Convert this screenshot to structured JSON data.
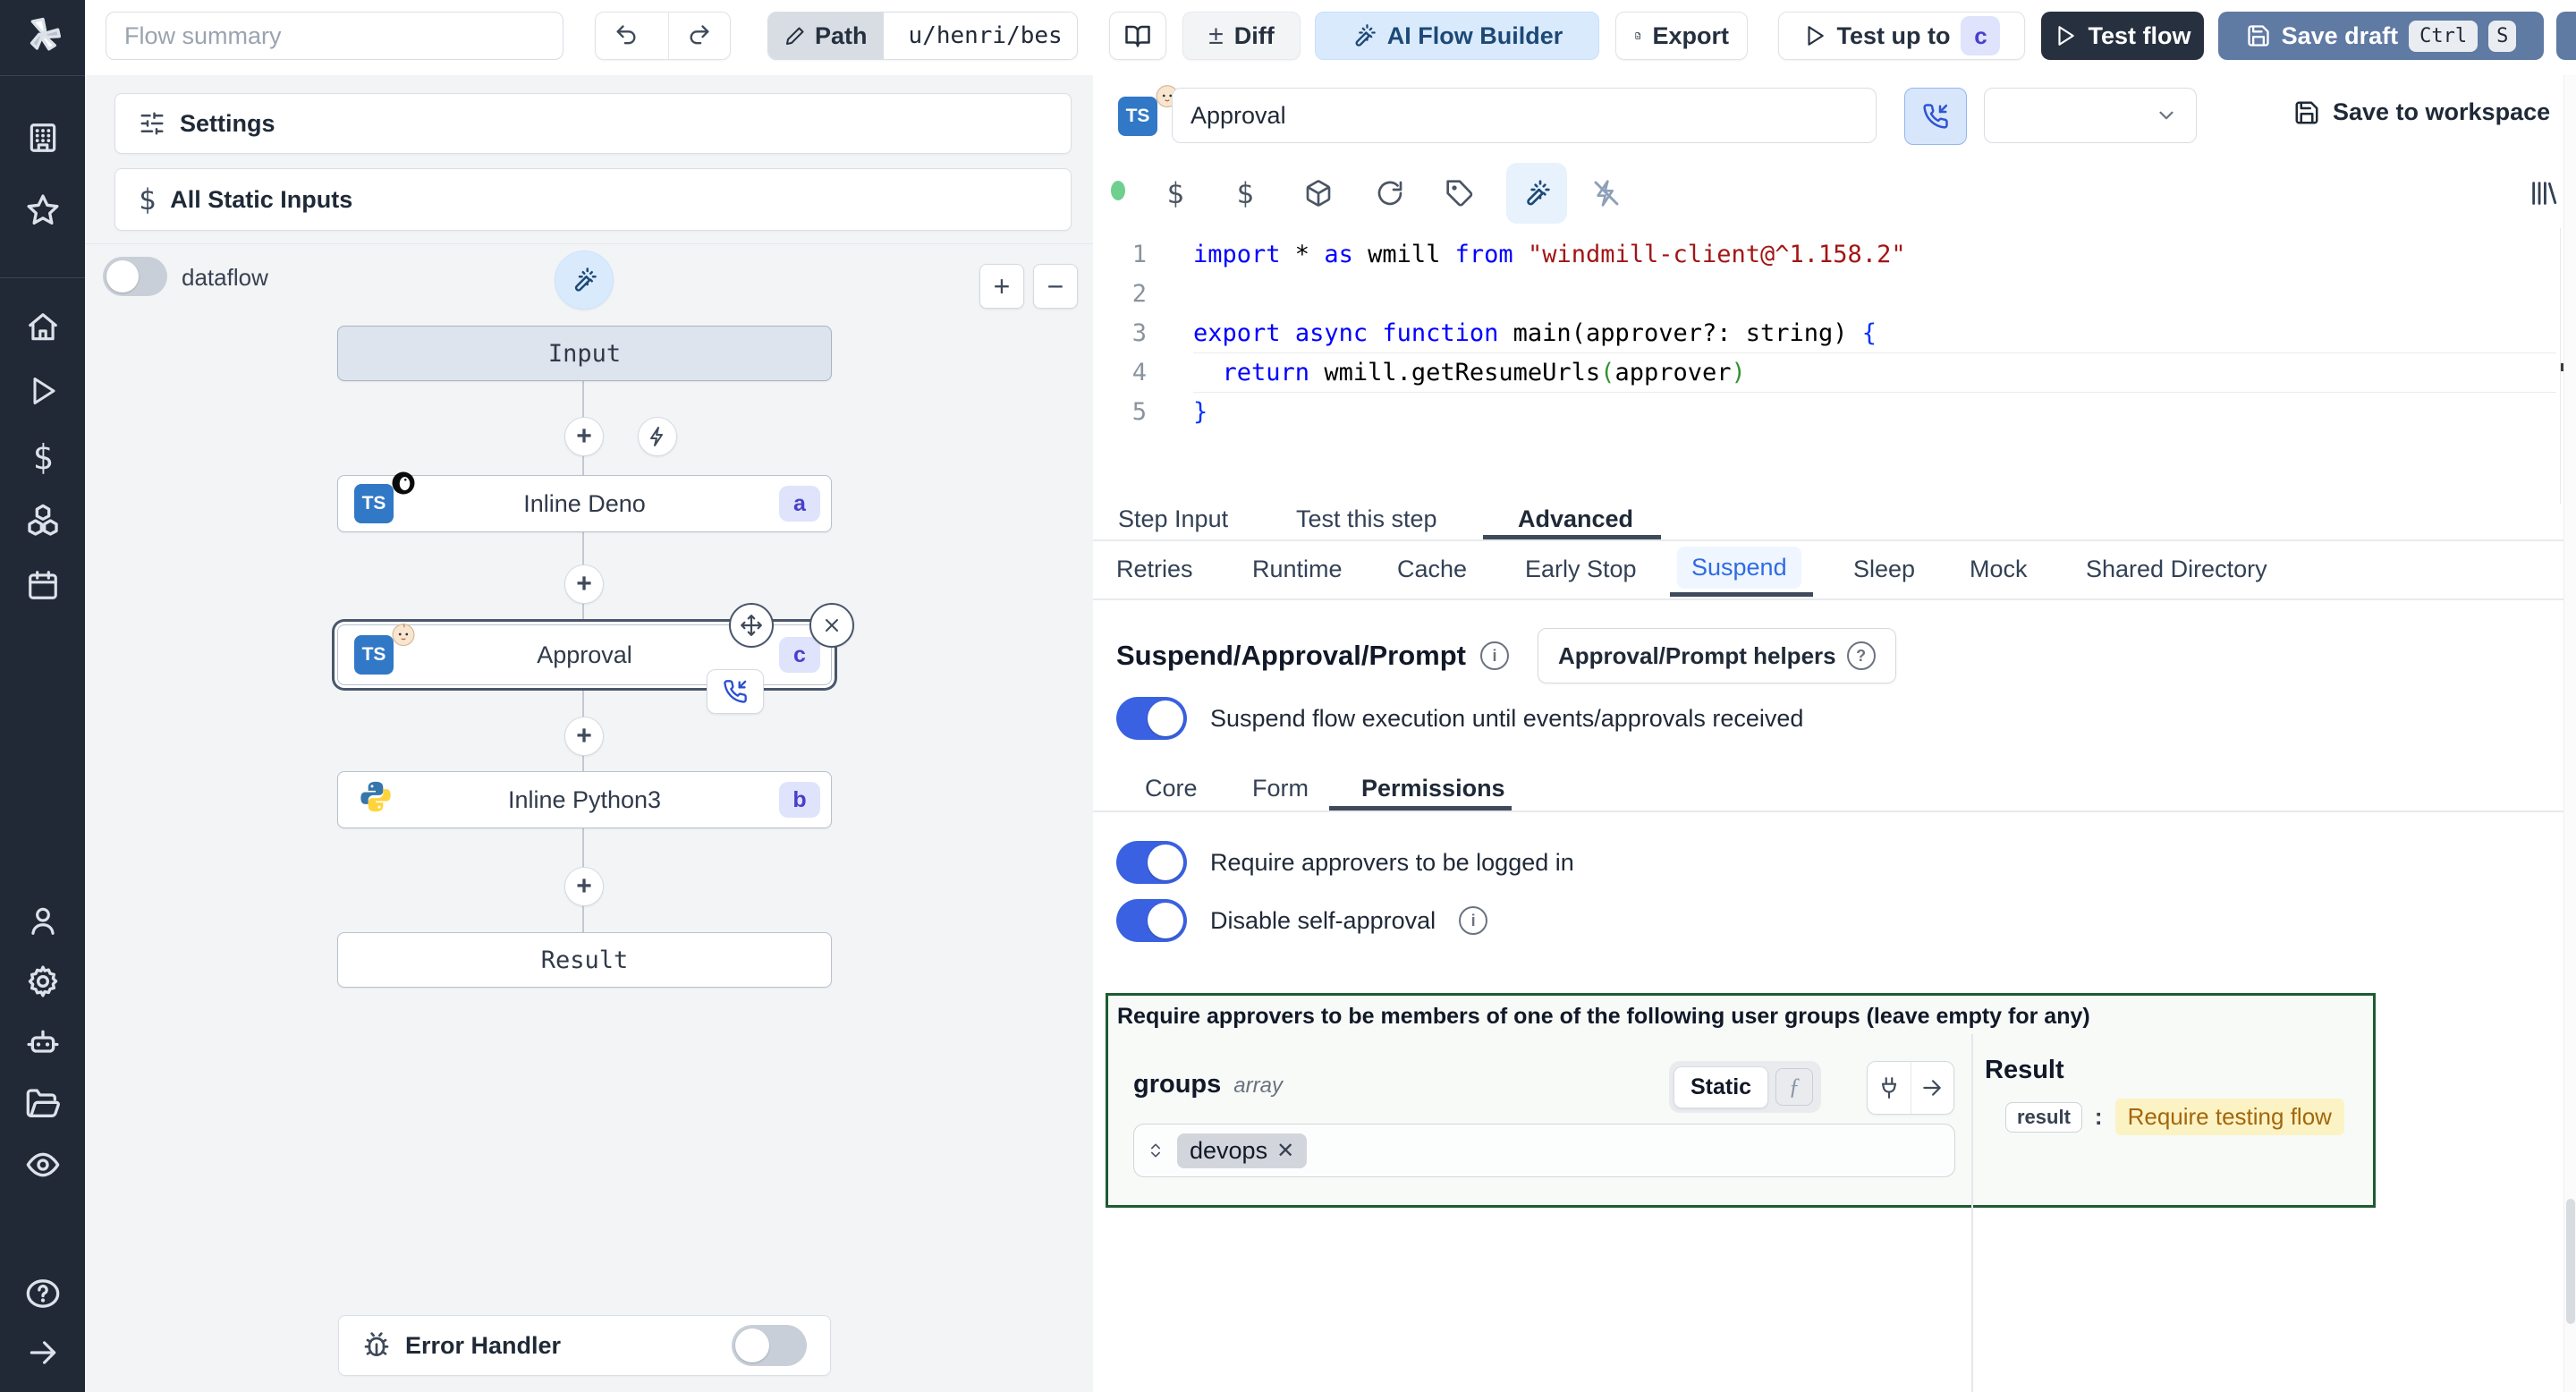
{
  "topbar": {
    "summary_placeholder": "Flow summary",
    "path_label": "Path",
    "path_value": "u/henri/bes",
    "diff_label": "Diff",
    "ai_builder_label": "AI Flow Builder",
    "export_label": "Export",
    "test_up_to_label": "Test up to",
    "test_up_to_badge": "c",
    "test_flow_label": "Test flow",
    "save_draft_label": "Save draft",
    "kbd": [
      "Ctrl",
      "S"
    ]
  },
  "rail": {
    "icons": [
      "windmill-logo",
      "workspace",
      "favorites",
      "home",
      "runs",
      "variables",
      "resources",
      "schedules",
      "users",
      "settings",
      "workers",
      "folders",
      "audit-logs",
      "help",
      "expand-sidebar"
    ]
  },
  "left_panel": {
    "settings_label": "Settings",
    "static_inputs_label": "All Static Inputs",
    "dataflow_label": "dataflow",
    "zoom_in": "+",
    "zoom_out": "−",
    "error_handler_label": "Error Handler"
  },
  "graph": {
    "input_label": "Input",
    "result_label": "Result",
    "nodes": [
      {
        "title": "Inline Deno",
        "badge": "a"
      },
      {
        "title": "Approval",
        "badge": "c"
      },
      {
        "title": "Inline Python3",
        "badge": "b"
      }
    ]
  },
  "step_editor": {
    "name_value": "Approval",
    "save_to_workspace": "Save to workspace",
    "code": {
      "lines": [
        [
          {
            "t": "import",
            "c": "kw"
          },
          {
            "t": " * ",
            "c": "d"
          },
          {
            "t": "as",
            "c": "kw"
          },
          {
            "t": " wmill ",
            "c": "d"
          },
          {
            "t": "from",
            "c": "kw"
          },
          {
            "t": " ",
            "c": "d"
          },
          {
            "t": "\"windmill-client@^1.158.2\"",
            "c": "str"
          }
        ],
        [],
        [
          {
            "t": "export",
            "c": "kw"
          },
          {
            "t": " ",
            "c": "d"
          },
          {
            "t": "async",
            "c": "kw"
          },
          {
            "t": " ",
            "c": "d"
          },
          {
            "t": "function",
            "c": "kw"
          },
          {
            "t": " main(approver?: string",
            "c": "d"
          },
          {
            "t": ") ",
            "c": "d"
          },
          {
            "t": "{",
            "c": "br"
          }
        ],
        [
          {
            "t": "  ",
            "c": "d"
          },
          {
            "t": "return",
            "c": "kw"
          },
          {
            "t": " wmill.getResumeUrls",
            "c": "d"
          },
          {
            "t": "(",
            "c": "gr"
          },
          {
            "t": "approver",
            "c": "d"
          },
          {
            "t": ")",
            "c": "gr"
          }
        ],
        [
          {
            "t": "}",
            "c": "br"
          }
        ]
      ]
    }
  },
  "tabs": {
    "main": [
      "Step Input",
      "Test this step",
      "Advanced"
    ],
    "main_active": "Advanced",
    "advanced": [
      "Retries",
      "Runtime",
      "Cache",
      "Early Stop",
      "Suspend",
      "Sleep",
      "Mock",
      "Shared Directory"
    ],
    "advanced_active": "Suspend"
  },
  "suspend": {
    "heading": "Suspend/Approval/Prompt",
    "helpers_button": "Approval/Prompt helpers",
    "toggle_main": "Suspend flow execution until events/approvals received",
    "sub_tabs": [
      "Core",
      "Form",
      "Permissions"
    ],
    "sub_tabs_active": "Permissions",
    "toggle_logged_in": "Require approvers to be logged in",
    "toggle_self_approval": "Disable self-approval",
    "groups_box_label": "Require approvers to be members of one of the following user groups (leave empty for any)",
    "groups_field": {
      "name": "groups",
      "type": "array",
      "mode": "Static",
      "chips": [
        "devops"
      ]
    },
    "result_panel": {
      "title": "Result",
      "key": "result",
      "value": "Require testing flow"
    }
  },
  "colors": {
    "accent_blue": "#3a61e2",
    "ai_button_bg": "#d9eafd",
    "save_draft_bg": "#5f7aa3",
    "dark_button_bg": "#27303f",
    "green_box_border": "#1d5c33",
    "badge_bg": "#dfe3fb",
    "badge_text": "#4840c9",
    "result_value_bg": "#fcf3c5",
    "result_value_text": "#a3660a"
  }
}
